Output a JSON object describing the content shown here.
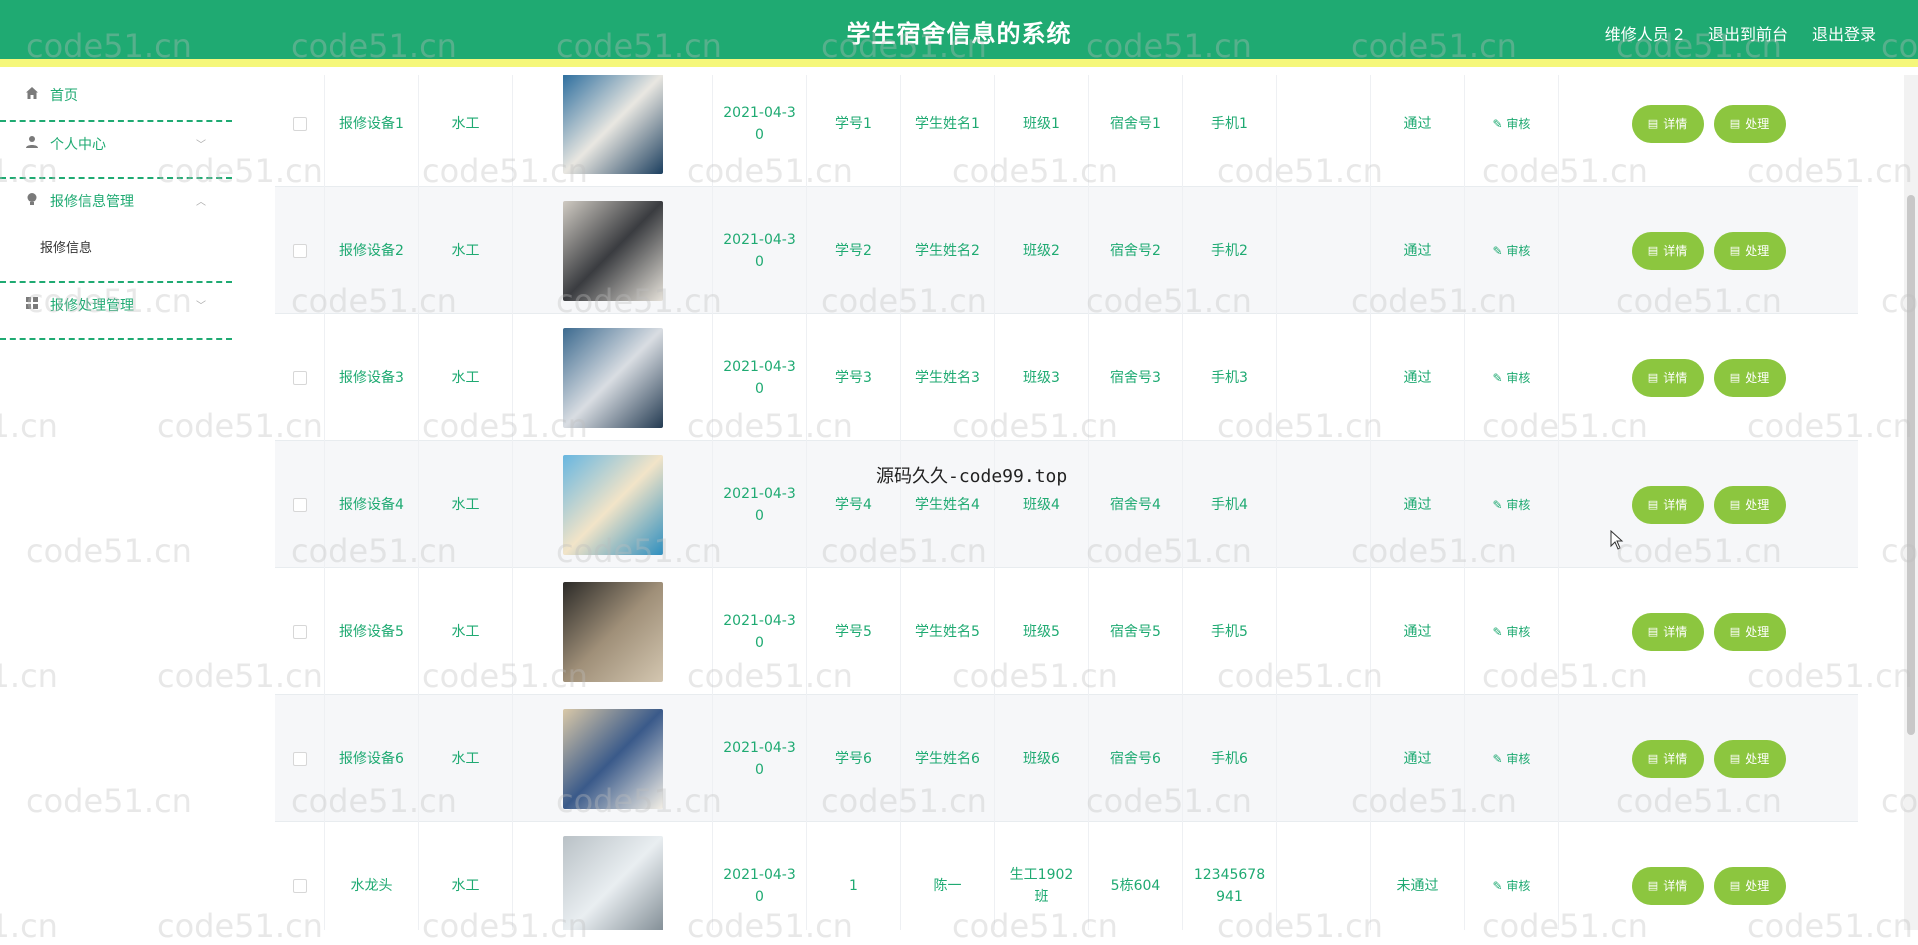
{
  "header": {
    "title": "学生宿舍信息的系统",
    "links": [
      "维修人员 2",
      "退出到前台",
      "退出登录"
    ]
  },
  "sidebar": {
    "home": "首页",
    "personal": "个人中心",
    "repair_info_mgmt": "报修信息管理",
    "repair_info": "报修信息",
    "repair_process_mgmt": "报修处理管理"
  },
  "table": {
    "buttons": {
      "detail": "详情",
      "process": "处理",
      "audit": "审核"
    },
    "rows": [
      {
        "device": "报修设备1",
        "type": "水工",
        "date": "2021-04-30",
        "sno": "学号1",
        "sname": "学生姓名1",
        "cls": "班级1",
        "dorm": "宿舍号1",
        "phone": "手机1",
        "status": "通过"
      },
      {
        "device": "报修设备2",
        "type": "水工",
        "date": "2021-04-30",
        "sno": "学号2",
        "sname": "学生姓名2",
        "cls": "班级2",
        "dorm": "宿舍号2",
        "phone": "手机2",
        "status": "通过"
      },
      {
        "device": "报修设备3",
        "type": "水工",
        "date": "2021-04-30",
        "sno": "学号3",
        "sname": "学生姓名3",
        "cls": "班级3",
        "dorm": "宿舍号3",
        "phone": "手机3",
        "status": "通过"
      },
      {
        "device": "报修设备4",
        "type": "水工",
        "date": "2021-04-30",
        "sno": "学号4",
        "sname": "学生姓名4",
        "cls": "班级4",
        "dorm": "宿舍号4",
        "phone": "手机4",
        "status": "通过"
      },
      {
        "device": "报修设备5",
        "type": "水工",
        "date": "2021-04-30",
        "sno": "学号5",
        "sname": "学生姓名5",
        "cls": "班级5",
        "dorm": "宿舍号5",
        "phone": "手机5",
        "status": "通过"
      },
      {
        "device": "报修设备6",
        "type": "水工",
        "date": "2021-04-30",
        "sno": "学号6",
        "sname": "学生姓名6",
        "cls": "班级6",
        "dorm": "宿舍号6",
        "phone": "手机6",
        "status": "通过"
      },
      {
        "device": "水龙头",
        "type": "水工",
        "date": "2021-04-30",
        "sno": "1",
        "sname": "陈一",
        "cls": "生工1902班",
        "dorm": "5栋604",
        "phone": "12345678941",
        "status": "未通过"
      }
    ]
  },
  "overlay_text": "源码久久-code99.top",
  "watermark": "code51.cn",
  "colors": {
    "header": "#1faa72",
    "accent_strip": "#f5f77a",
    "button": "#8cc63f"
  }
}
